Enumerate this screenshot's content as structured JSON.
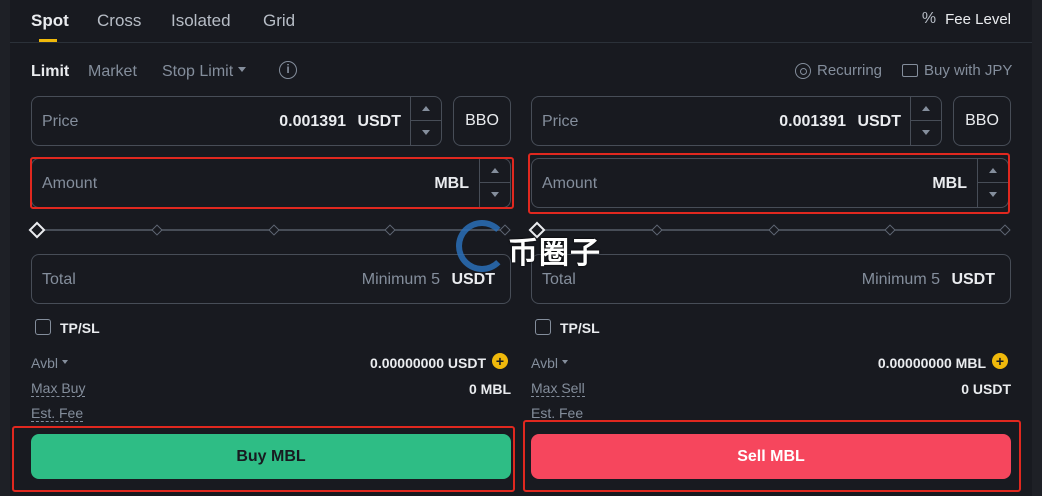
{
  "top_tabs": [
    "Spot",
    "Cross",
    "Isolated",
    "Grid"
  ],
  "fee_level": {
    "icon": "percent-icon",
    "label": "Fee Level"
  },
  "order_types": {
    "limit": "Limit",
    "market": "Market",
    "stop_limit": "Stop Limit",
    "info_icon": "i"
  },
  "header_links": {
    "recurring": "Recurring",
    "buy_jpy": "Buy with JPY"
  },
  "buy_panel": {
    "price": {
      "label": "Price",
      "value": "0.001391",
      "unit": "USDT",
      "bbo": "BBO"
    },
    "amount": {
      "label": "Amount",
      "unit": "MBL"
    },
    "total": {
      "label": "Total",
      "hint": "Minimum 5",
      "unit": "USDT"
    },
    "tpsl": "TP/SL",
    "avbl": {
      "label": "Avbl",
      "value": "0.00000000 USDT"
    },
    "max": {
      "label": "Max Buy",
      "value": "0 MBL"
    },
    "fee": {
      "label": "Est. Fee"
    },
    "button": "Buy MBL"
  },
  "sell_panel": {
    "price": {
      "label": "Price",
      "value": "0.001391",
      "unit": "USDT",
      "bbo": "BBO"
    },
    "amount": {
      "label": "Amount",
      "unit": "MBL"
    },
    "total": {
      "label": "Total",
      "hint": "Minimum 5",
      "unit": "USDT"
    },
    "tpsl": "TP/SL",
    "avbl": {
      "label": "Avbl",
      "value": "0.00000000 MBL"
    },
    "max": {
      "label": "Max Sell",
      "value": "0 USDT"
    },
    "fee": {
      "label": "Est. Fee"
    },
    "button": "Sell MBL"
  },
  "plus_symbol": "+",
  "watermark": {
    "text": "币圈子"
  },
  "colors": {
    "accent": "#f0b90b",
    "buy": "#2ebd85",
    "sell": "#f6465d",
    "highlight": "#e0281f"
  }
}
